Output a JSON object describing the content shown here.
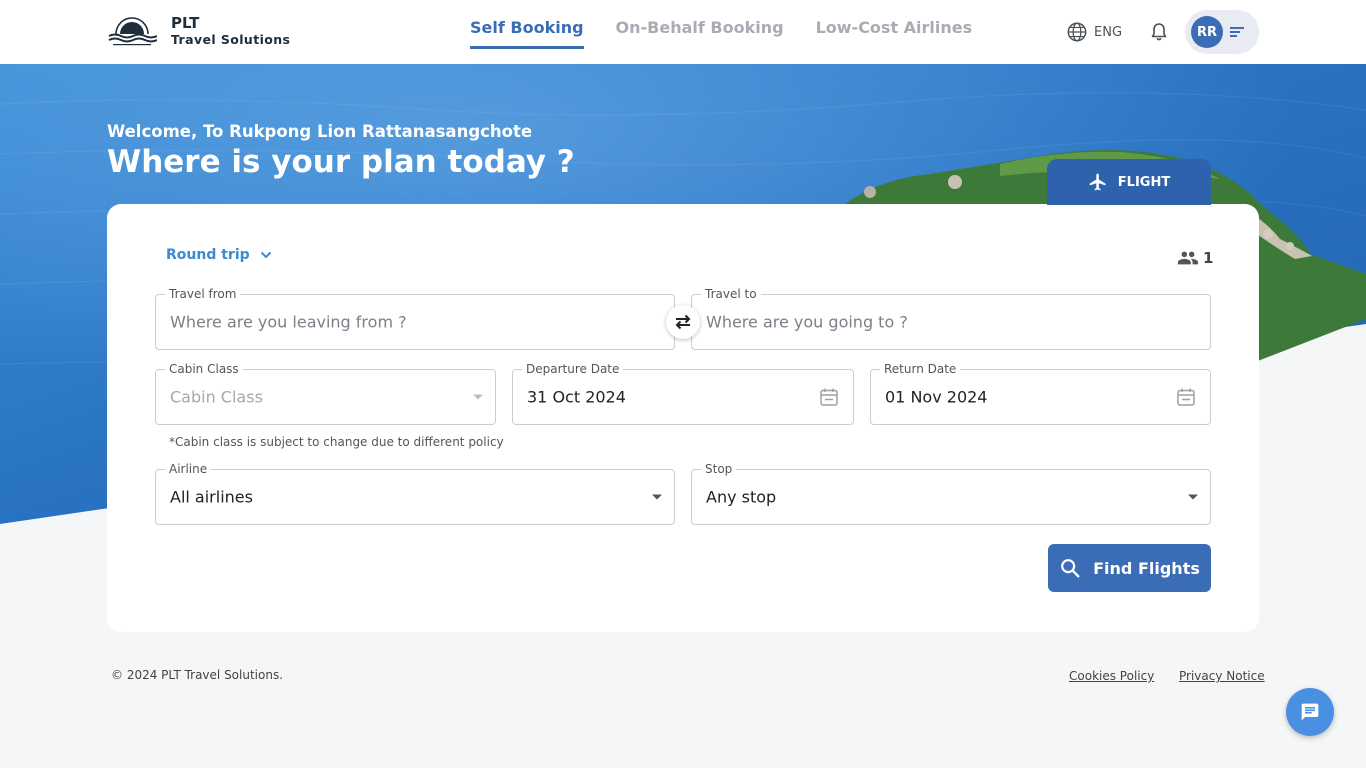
{
  "brand": {
    "name": "PLT",
    "subtitle": "Travel Solutions"
  },
  "nav": {
    "tabs": [
      {
        "label": "Self Booking",
        "active": true
      },
      {
        "label": "On-Behalf Booking",
        "active": false
      },
      {
        "label": "Low-Cost Airlines",
        "active": false
      }
    ]
  },
  "header": {
    "language": "ENG",
    "user_initials": "RR",
    "icons": [
      "globe-icon",
      "bell-icon",
      "menu-icon"
    ]
  },
  "hero": {
    "welcome": "Welcome, To Rukpong Lion Rattanasangchote",
    "headline": "Where is your plan today ?"
  },
  "product_tab": {
    "label": "FLIGHT",
    "icon": "airplane-icon"
  },
  "search": {
    "trip_type": "Round trip",
    "passengers": "1",
    "travel_from": {
      "label": "Travel from",
      "placeholder": "Where are you leaving from ?"
    },
    "travel_to": {
      "label": "Travel to",
      "placeholder": "Where are you going to ?"
    },
    "cabin_class": {
      "label": "Cabin Class",
      "placeholder": "Cabin Class"
    },
    "departure_date": {
      "label": "Departure Date",
      "value": "31 Oct 2024"
    },
    "return_date": {
      "label": "Return Date",
      "value": "01 Nov 2024"
    },
    "cabin_note": "*Cabin class is subject to change due to different policy",
    "airline": {
      "label": "Airline",
      "value": "All airlines"
    },
    "stop": {
      "label": "Stop",
      "value": "Any stop"
    },
    "find_button": "Find Flights"
  },
  "footer": {
    "copyright": "© 2024 PLT Travel Solutions.",
    "cookies": "Cookies Policy",
    "privacy": "Privacy Notice"
  },
  "colors": {
    "primary": "#3a6db5",
    "accent": "#3a8bd0",
    "chat": "#4a90e2",
    "sea": "#2f7fd0"
  }
}
